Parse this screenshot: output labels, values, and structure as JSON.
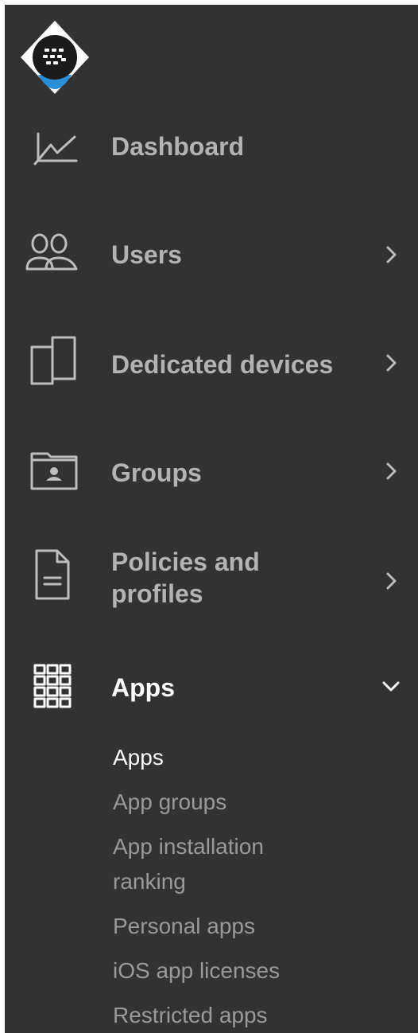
{
  "colors": {
    "sidebar_bg": "#323232",
    "icon_color": "#bdbdbd",
    "label_color": "#b3b3b3",
    "active_color": "#ffffff",
    "logo_accent": "#2a8fd6"
  },
  "logo": {
    "icon": "blackberry-logo-icon"
  },
  "nav": {
    "items": [
      {
        "label": "Dashboard",
        "icon": "chart-line-icon"
      },
      {
        "label": "Users",
        "icon": "users-icon",
        "chevron": "chevron-right-icon"
      },
      {
        "label": "Dedicated devices",
        "icon": "devices-icon",
        "chevron": "chevron-right-icon"
      },
      {
        "label": "Groups",
        "icon": "folder-user-icon",
        "chevron": "chevron-right-icon"
      },
      {
        "label_line1": "Policies and",
        "label_line2": "profiles",
        "icon": "document-icon",
        "chevron": "chevron-right-icon"
      },
      {
        "label": "Apps",
        "icon": "apps-grid-icon",
        "chevron": "chevron-down-icon",
        "expanded": true
      }
    ]
  },
  "apps_submenu": {
    "items": [
      {
        "label": "Apps",
        "active": true
      },
      {
        "label": "App groups"
      },
      {
        "label_line1": "App installation",
        "label_line2": "ranking"
      },
      {
        "label": "Personal apps"
      },
      {
        "label": "iOS app licenses"
      },
      {
        "label": "Restricted apps"
      }
    ]
  }
}
